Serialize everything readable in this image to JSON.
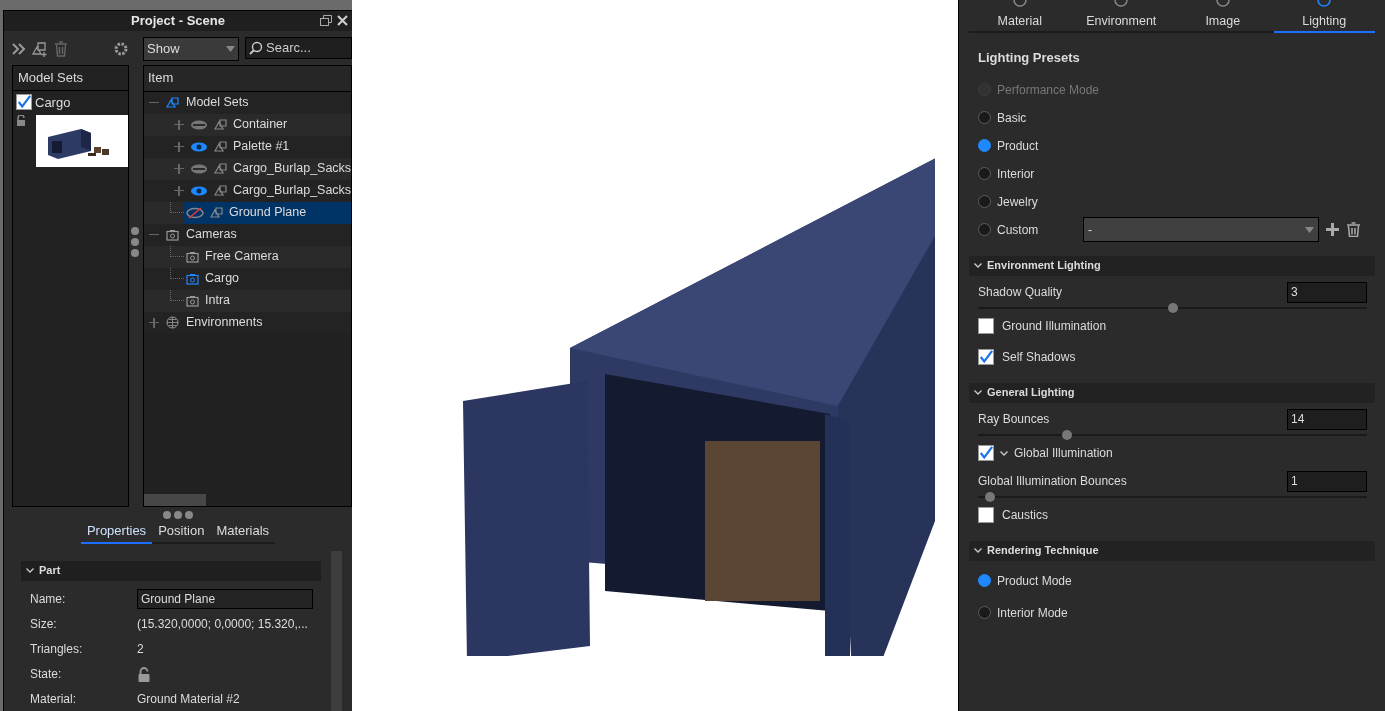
{
  "scene_panel": {
    "title": "Project - Scene",
    "show_dropdown": {
      "value": "Show"
    },
    "search": {
      "placeholder": "Searc..."
    },
    "model_sets": {
      "header": "Model Sets",
      "items": [
        {
          "label": "Cargo",
          "checked": true
        }
      ]
    },
    "tree": {
      "header": "Item",
      "nodes": [
        {
          "label": "Model Sets",
          "kind": "modelset",
          "expanded": true,
          "children": [
            {
              "label": "Container",
              "kind": "part",
              "visible": true,
              "partial": true,
              "selected": false
            },
            {
              "label": "Palette #1",
              "kind": "part",
              "visible": true,
              "partial": false,
              "selected": false
            },
            {
              "label": "Cargo_Burlap_Sacks",
              "kind": "part",
              "visible": true,
              "partial": true,
              "selected": false
            },
            {
              "label": "Cargo_Burlap_Sacks",
              "kind": "part",
              "visible": true,
              "partial": false,
              "selected": false
            },
            {
              "label": "Ground Plane",
              "kind": "leaf",
              "visible": false,
              "selected": true
            }
          ]
        },
        {
          "label": "Cameras",
          "kind": "camera",
          "expanded": true,
          "children": [
            {
              "label": "Free Camera",
              "kind": "camera",
              "active": false,
              "selected": false
            },
            {
              "label": "Cargo",
              "kind": "camera",
              "active": true,
              "selected": false
            },
            {
              "label": "Intra",
              "kind": "camera",
              "active": false,
              "selected": false
            }
          ]
        },
        {
          "label": "Environments",
          "kind": "environment",
          "expanded": false
        }
      ]
    },
    "tabs": [
      {
        "label": "Properties",
        "selected": true
      },
      {
        "label": "Position",
        "selected": false
      },
      {
        "label": "Materials",
        "selected": false
      }
    ],
    "section": "Part",
    "properties": [
      {
        "label": "Name:",
        "kind": "field",
        "value": "Ground Plane"
      },
      {
        "label": "Size:",
        "kind": "text",
        "value": "(15.320,0000; 0,0000; 15.320,..."
      },
      {
        "label": "Triangles:",
        "kind": "text",
        "value": "2"
      },
      {
        "label": "State:",
        "kind": "lock"
      },
      {
        "label": "Material:",
        "kind": "text",
        "value": "Ground Material #2"
      }
    ]
  },
  "settings_panel": {
    "tabs": [
      {
        "label": "Material",
        "selected": false
      },
      {
        "label": "Environment",
        "selected": false
      },
      {
        "label": "Image",
        "selected": false
      },
      {
        "label": "Lighting",
        "selected": true
      }
    ],
    "presets_title": "Lighting Presets",
    "presets": [
      {
        "label": "Performance Mode",
        "selected": false,
        "disabled": true
      },
      {
        "label": "Basic",
        "selected": false,
        "disabled": false
      },
      {
        "label": "Product",
        "selected": true,
        "disabled": false
      },
      {
        "label": "Interior",
        "selected": false,
        "disabled": false
      },
      {
        "label": "Jewelry",
        "selected": false,
        "disabled": false
      },
      {
        "label": "Custom",
        "selected": false,
        "disabled": false
      }
    ],
    "custom_dropdown": {
      "value": "-"
    },
    "sections": [
      {
        "title": "Environment Lighting",
        "items": [
          {
            "kind": "slider",
            "label": "Shadow Quality",
            "value": "3",
            "level": 0.5
          },
          {
            "kind": "checkbox",
            "label": "Ground Illumination",
            "checked": false
          },
          {
            "kind": "checkbox",
            "label": "Self Shadows",
            "checked": true
          }
        ]
      },
      {
        "title": "General Lighting",
        "items": [
          {
            "kind": "slider",
            "label": "Ray Bounces",
            "value": "14",
            "level": 0.23
          },
          {
            "kind": "checkbox_group",
            "label": "Global Illumination",
            "checked": true
          },
          {
            "kind": "slider",
            "label": "Global Illumination Bounces",
            "value": "1",
            "level": 0.03
          },
          {
            "kind": "checkbox",
            "label": "Caustics",
            "checked": false
          }
        ]
      },
      {
        "title": "Rendering Technique",
        "items": [
          {
            "kind": "radio",
            "label": "Product Mode",
            "selected": true
          },
          {
            "kind": "radio",
            "label": "Interior Mode",
            "selected": false
          }
        ]
      }
    ]
  }
}
